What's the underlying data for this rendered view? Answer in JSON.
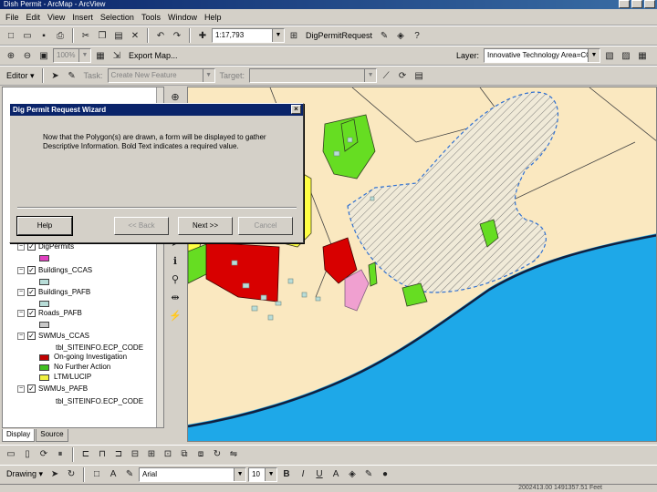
{
  "window": {
    "title": "Dish Permit - ArcMap - ArcView"
  },
  "menu": [
    "File",
    "Edit",
    "View",
    "Insert",
    "Selection",
    "Tools",
    "Window",
    "Help"
  ],
  "toolbar1": {
    "scale": "1:17,793",
    "tool_label": "DigPermitRequest"
  },
  "toolbar2": {
    "zoom": "100%",
    "export_label": "Export Map...",
    "layer_label": "Layer:",
    "layer_value": "Innovative Technology Area=CC"
  },
  "toolbar3": {
    "editor_label": "Editor ▾",
    "task_label": "Task:",
    "task_value": "Create New Feature",
    "target_label": "Target:"
  },
  "toc": {
    "layers": [
      {
        "name": "DigPermits",
        "checked": true,
        "swatch": "#e040c0"
      },
      {
        "name": "Buildings_CCAS",
        "checked": true,
        "swatch": "#b8ddd8"
      },
      {
        "name": "Buildings_PAFB",
        "checked": true,
        "swatch": "#b8ddd8"
      },
      {
        "name": "Roads_PAFB",
        "checked": true,
        "swatch": "#c8c8c8"
      },
      {
        "name": "SWMUs_CCAS",
        "checked": true
      },
      {
        "name": "SWMUs_PAFB",
        "checked": true
      }
    ],
    "legend_field": "tbl_SITEINFO.ECP_CODE",
    "legend": [
      {
        "label": "On-going Investigation",
        "color": "#c00000"
      },
      {
        "label": "No Further Action",
        "color": "#40c020"
      },
      {
        "label": "LTM/LUCIP",
        "color": "#f0f040"
      }
    ],
    "legend_field2": "tbl_SITEINFO.ECP_CODE"
  },
  "tabs": [
    "Display",
    "Source"
  ],
  "dialog": {
    "title": "Dig Permit Request Wizard",
    "text": "Now that the Polygon(s) are drawn, a form will be displayed to gather Descriptive Information. Bold Text indicates a required value.",
    "buttons": {
      "help": "Help",
      "back": "<< Back",
      "next": "Next >>",
      "cancel": "Cancel"
    }
  },
  "drawing": {
    "label": "Drawing ▾",
    "font": "Arial",
    "size": "10"
  },
  "status": {
    "coords": "2002413.00  1491357.51 Feet"
  },
  "colors": {
    "water": "#1ea8e8",
    "land": "#fae8c0",
    "green": "#66dd22",
    "red": "#d80000",
    "yellow": "#ffff44",
    "pink": "#f0a0d0"
  }
}
